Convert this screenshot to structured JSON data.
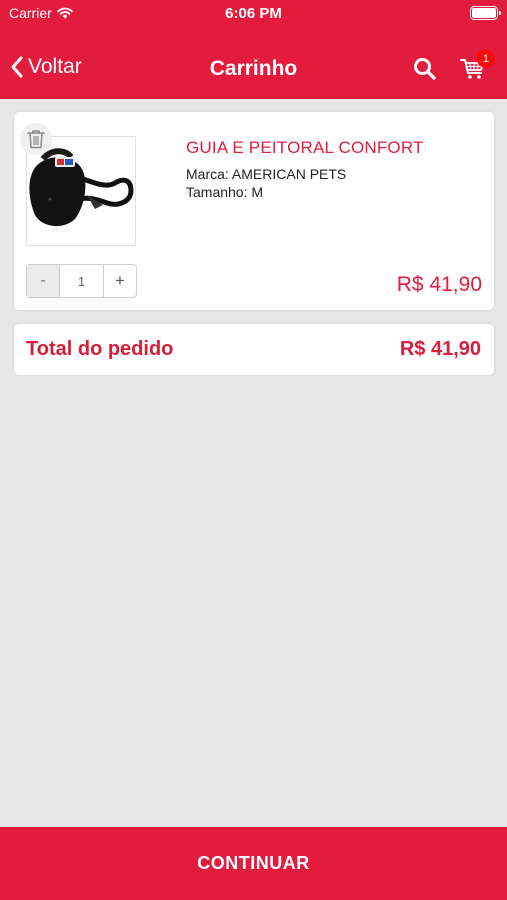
{
  "status_bar": {
    "carrier": "Carrier",
    "time": "6:06 PM"
  },
  "nav": {
    "back_label": "Voltar",
    "title": "Carrinho",
    "cart_count": "1"
  },
  "cart": {
    "item": {
      "name": "GUIA E PEITORAL CONFORT",
      "brand": "Marca: AMERICAN PETS",
      "size": "Tamanho: M",
      "quantity": "1",
      "minus_label": "-",
      "plus_label": "+",
      "price": "R$ 41,90"
    },
    "total_label": "Total do pedido",
    "total_value": "R$ 41,90"
  },
  "footer": {
    "continue_label": "CONTINUAR"
  },
  "colors": {
    "brand_red": "#e31c3d",
    "background": "#e6e6e6",
    "badge_red": "#ff0a0a"
  },
  "icons": [
    "wifi-icon",
    "battery-icon",
    "chevron-left-icon",
    "search-icon",
    "cart-icon",
    "trash-icon"
  ]
}
